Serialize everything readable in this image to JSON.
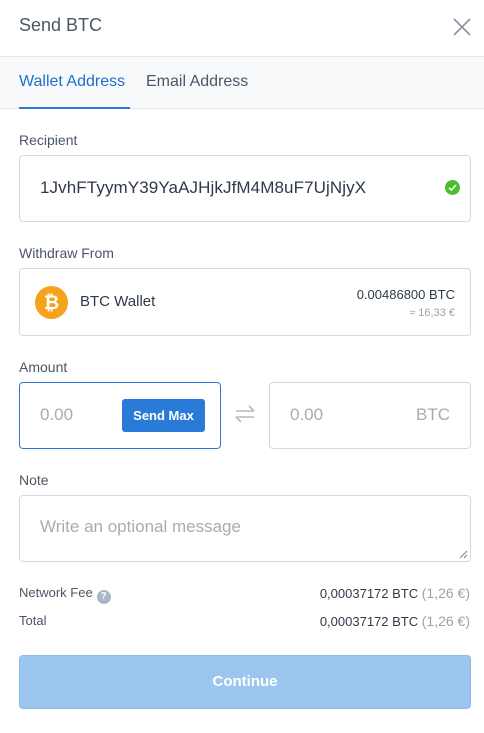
{
  "header": {
    "title": "Send BTC"
  },
  "tabs": [
    {
      "label": "Wallet Address",
      "active": true
    },
    {
      "label": "Email Address",
      "active": false
    }
  ],
  "recipient": {
    "label": "Recipient",
    "value": "1JvhFTyymY39YaAJHjkJfM4M8uF7UjNjyX"
  },
  "withdraw": {
    "label": "Withdraw From",
    "wallet_name": "BTC Wallet",
    "balance": "0.00486800 BTC",
    "fiat": "≈ 16,33 €",
    "coin_color": "#f7a21b"
  },
  "amount": {
    "label": "Amount",
    "crypto_placeholder": "0.00",
    "send_max_label": "Send Max",
    "fiat_placeholder": "0.00",
    "unit": "BTC"
  },
  "note": {
    "label": "Note",
    "placeholder": "Write an optional message"
  },
  "summary": {
    "network_fee_label": "Network Fee",
    "network_fee_value": "0,00037172 BTC",
    "network_fee_fiat": "(1,26 €)",
    "total_label": "Total",
    "total_value": "0,00037172 BTC",
    "total_fiat": "(1,26 €)"
  },
  "continue_label": "Continue",
  "colors": {
    "accent": "#2a7ad8",
    "valid": "#4cbe2e",
    "continue_disabled": "#9cc6ef"
  }
}
